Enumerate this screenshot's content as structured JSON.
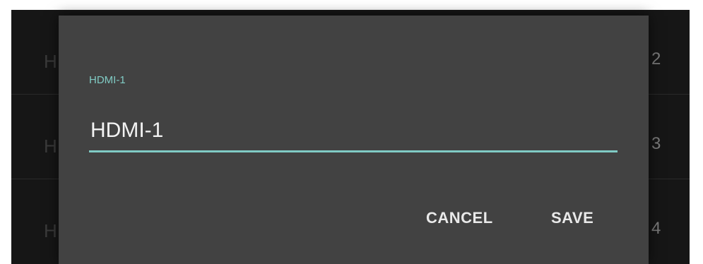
{
  "background_list": {
    "rows": [
      {
        "left_text": "H",
        "right_text": "2"
      },
      {
        "left_text": "H",
        "right_text": "3"
      },
      {
        "left_text": "H",
        "right_text": "4"
      }
    ]
  },
  "dialog": {
    "field_label": "HDMI-1",
    "field_value": "HDMI-1",
    "cancel_label": "CANCEL",
    "save_label": "SAVE"
  },
  "colors": {
    "accent": "#80cbc4",
    "dialog_background": "#424242",
    "screen_background": "#161616"
  }
}
